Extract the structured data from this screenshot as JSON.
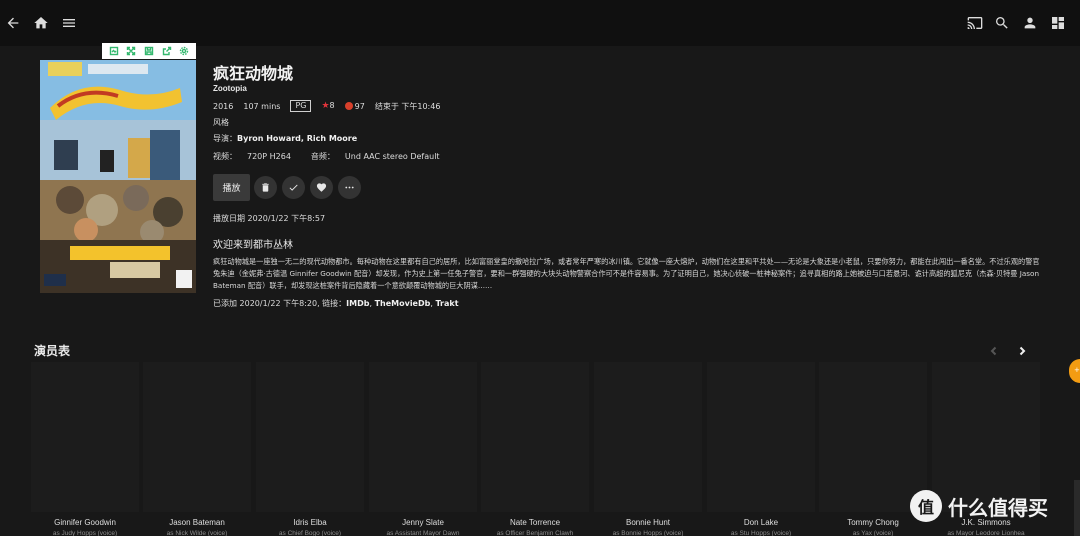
{
  "topbar": {
    "icons": [
      "back-arrow-icon",
      "home-icon",
      "menu-icon",
      "cast-icon",
      "search-icon",
      "user-icon",
      "dashboard-icon"
    ]
  },
  "poster_toolbar": {
    "icons": [
      "edit-image-icon",
      "fullscreen-icon",
      "save-icon",
      "share-icon",
      "settings-icon"
    ],
    "accent": "#34b86e"
  },
  "movie": {
    "title": "疯狂动物城",
    "original_title": "Zootopia",
    "year": "2016",
    "runtime": "107 mins",
    "rating": "PG",
    "community_rating": "8",
    "critic_rating": "97",
    "ends_at": "结束于 下午10:46",
    "genre_label": "风格",
    "director_label": "导演：",
    "directors": "Byron Howard, Rich Moore",
    "video_label": "视频：",
    "video_value": "720P H264",
    "audio_label": "音频：",
    "audio_value": "Und AAC stereo Default",
    "played_date": "播放日期 2020/1/22 下午8:57",
    "tagline": "欢迎来到都市丛林",
    "overview": "疯狂动物城是一座独一无二的现代动物都市。每种动物在这里都有自己的居所，比如富丽堂皇的撒哈拉广场，或者常年严寒的冰川镇。它就像一座大熔炉，动物们在这里和平共处——无论是大象还是小老鼠，只要你努力，都能在此闯出一番名堂。不过乐观的警官兔朱迪（金妮弗·古德温 Ginnifer Goodwin 配音）却发现，作为史上第一任兔子警官，要和一群强硬的大块头动物警察合作可不是件容易事。为了证明自己，她决心侦破一桩神秘案件；追寻真相的路上她被迫与口若悬河、诡计高超的狐尼克（杰森·贝特曼 Jason Bateman 配音）联手，却发现这桩案件背后隐藏着一个意欲颠覆动物城的巨大阴谋……",
    "added_prefix": "已添加 2020/1/22 下午8:20, 链接：",
    "links": [
      "IMDb",
      "TheMovieDb",
      "Trakt"
    ],
    "star_color": "#e0333a",
    "tomato_color": "#d8402b"
  },
  "actions": {
    "play_label": "播放",
    "icons": [
      "delete-icon",
      "check-icon",
      "heart-icon",
      "more-icon"
    ]
  },
  "cast": {
    "title": "演员表",
    "items": [
      {
        "name": "Ginnifer Goodwin",
        "role": "as Judy Hopps (voice)"
      },
      {
        "name": "Jason Bateman",
        "role": "as Nick Wilde (voice)"
      },
      {
        "name": "Idris Elba",
        "role": "as Chief Bogo (voice)"
      },
      {
        "name": "Jenny Slate",
        "role": "as Assistant Mayor Dawn"
      },
      {
        "name": "Nate Torrence",
        "role": "as Officer Benjamin Clawh"
      },
      {
        "name": "Bonnie Hunt",
        "role": "as Bonnie Hopps (voice)"
      },
      {
        "name": "Don Lake",
        "role": "as Stu Hopps (voice)"
      },
      {
        "name": "Tommy Chong",
        "role": "as Yax (voice)"
      },
      {
        "name": "J.K. Simmons",
        "role": "as Mayor Leodore Lionhea"
      }
    ]
  },
  "watermark": {
    "symbol": "值",
    "text": "什么值得买"
  }
}
